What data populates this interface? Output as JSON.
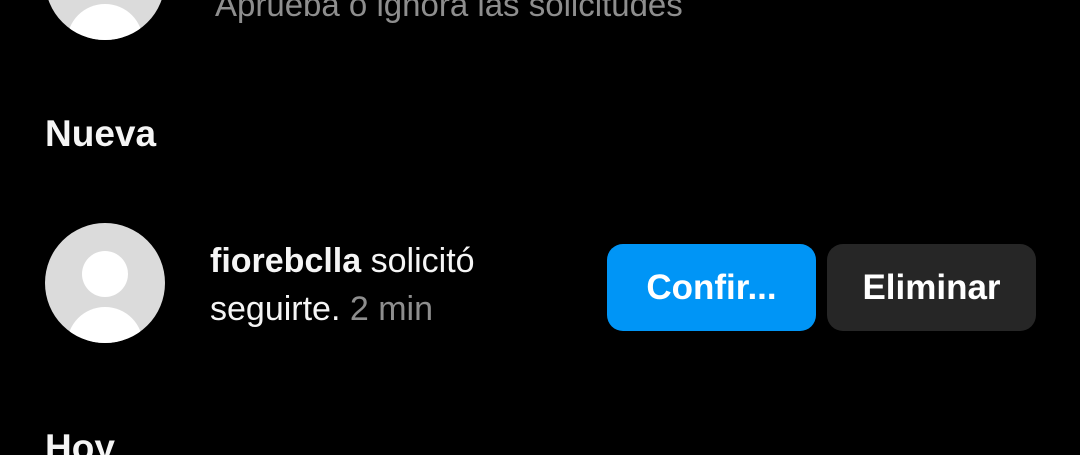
{
  "requests_summary": {
    "subtext": "Aprueba o ignora las solicitudes"
  },
  "sections": {
    "new_heading": "Nueva",
    "today_heading": "Hoy"
  },
  "request": {
    "username": "fiorebclla",
    "message_part1": " solicitó",
    "message_part2": "seguirte.",
    "time": " 2 min",
    "confirm_label": "Confir...",
    "delete_label": "Eliminar"
  },
  "colors": {
    "background": "#000000",
    "primary_button": "#0095f6",
    "secondary_button": "#262626",
    "secondary_text": "#8e8e8e",
    "avatar_placeholder": "#dbdbdb"
  }
}
